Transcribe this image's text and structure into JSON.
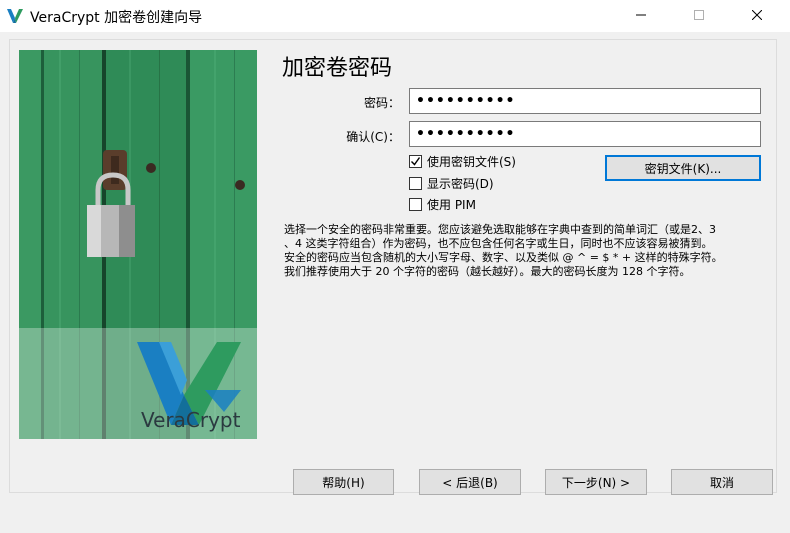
{
  "window": {
    "title": "VeraCrypt 加密卷创建向导",
    "icons": [
      "veracrypt-app-icon",
      "minimize-icon",
      "maximize-icon",
      "close-icon"
    ]
  },
  "branding": {
    "logo_text": "VeraCrypt"
  },
  "page": {
    "title": "加密卷密码"
  },
  "form": {
    "password_label": "密码：",
    "password_value": "••••••••••",
    "confirm_label": "确认(C)：",
    "confirm_value": "••••••••••",
    "use_keyfiles_label": "使用密钥文件(S)",
    "use_keyfiles_checked": true,
    "show_password_label": "显示密码(D)",
    "show_password_checked": false,
    "use_pim_label": "使用 PIM",
    "use_pim_checked": false,
    "keyfiles_button": "密钥文件(K)..."
  },
  "info": {
    "lines": [
      "选择一个安全的密码非常重要。您应该避免选取能够在字典中查到的简单词汇（或是2、3",
      "、4 这类字符组合）作为密码，也不应包含任何名字或生日，同时也不应该容易被猜到。",
      "安全的密码应当包含随机的大小写字母、数字、以及类似 @ ^ = $ * + 这样的特殊字符。",
      "我们推荐使用大于 20 个字符的密码（越长越好）。最大的密码长度为 128 个字符。"
    ]
  },
  "footer": {
    "help": "帮助(H)",
    "back": "< 后退(B)",
    "next": "下一步(N) >",
    "cancel": "取消"
  },
  "colors": {
    "accent": "#0078d7",
    "logo_blue": "#1a7fc2",
    "logo_green": "#2e9b5f"
  }
}
